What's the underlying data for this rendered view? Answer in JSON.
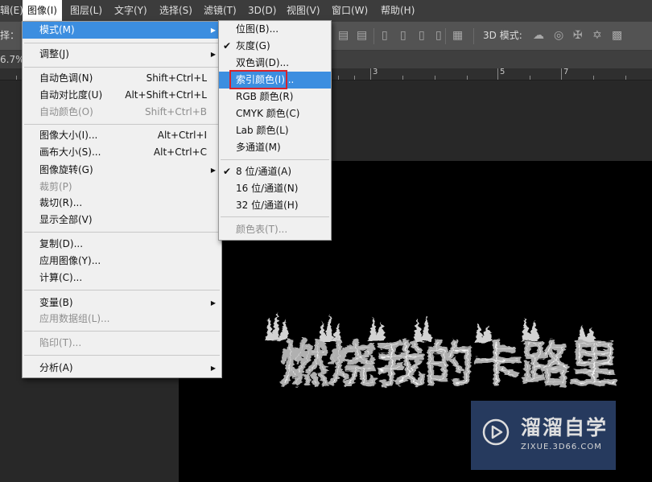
{
  "menubar": {
    "items": [
      {
        "label": "辑(E)"
      },
      {
        "label": "图像(I)"
      },
      {
        "label": "图层(L)"
      },
      {
        "label": "文字(Y)"
      },
      {
        "label": "选择(S)"
      },
      {
        "label": "滤镜(T)"
      },
      {
        "label": "3D(D)"
      },
      {
        "label": "视图(V)"
      },
      {
        "label": "窗口(W)"
      },
      {
        "label": "帮助(H)"
      }
    ]
  },
  "options_bar": {
    "select_label": "择：",
    "mode_3d_label": "3D 模式:"
  },
  "document": {
    "zoom": "6.7%"
  },
  "ruler": {
    "numbers": [
      "3",
      "5",
      "7"
    ]
  },
  "image_menu": {
    "items": [
      {
        "label": "模式(M)",
        "shortcut": ""
      },
      {
        "label": "调整(J)",
        "shortcut": ""
      },
      {
        "label": "自动色调(N)",
        "shortcut": "Shift+Ctrl+L"
      },
      {
        "label": "自动对比度(U)",
        "shortcut": "Alt+Shift+Ctrl+L"
      },
      {
        "label": "自动颜色(O)",
        "shortcut": "Shift+Ctrl+B"
      },
      {
        "label": "图像大小(I)...",
        "shortcut": "Alt+Ctrl+I"
      },
      {
        "label": "画布大小(S)...",
        "shortcut": "Alt+Ctrl+C"
      },
      {
        "label": "图像旋转(G)",
        "shortcut": ""
      },
      {
        "label": "裁剪(P)",
        "shortcut": ""
      },
      {
        "label": "裁切(R)...",
        "shortcut": ""
      },
      {
        "label": "显示全部(V)",
        "shortcut": ""
      },
      {
        "label": "复制(D)...",
        "shortcut": ""
      },
      {
        "label": "应用图像(Y)...",
        "shortcut": ""
      },
      {
        "label": "计算(C)...",
        "shortcut": ""
      },
      {
        "label": "变量(B)",
        "shortcut": ""
      },
      {
        "label": "应用数据组(L)...",
        "shortcut": ""
      },
      {
        "label": "陷印(T)...",
        "shortcut": ""
      },
      {
        "label": "分析(A)",
        "shortcut": ""
      }
    ]
  },
  "mode_submenu": {
    "items": [
      {
        "label": "位图(B)..."
      },
      {
        "label": "灰度(G)"
      },
      {
        "label": "双色调(D)..."
      },
      {
        "label": "索引颜色(I)..."
      },
      {
        "label": "RGB 颜色(R)"
      },
      {
        "label": "CMYK 颜色(C)"
      },
      {
        "label": "Lab 颜色(L)"
      },
      {
        "label": "多通道(M)"
      },
      {
        "label": "8 位/通道(A)"
      },
      {
        "label": "16 位/通道(N)"
      },
      {
        "label": "32 位/通道(H)"
      },
      {
        "label": "颜色表(T)..."
      }
    ]
  },
  "canvas": {
    "text": "燃烧我的卡路里"
  },
  "watermark": {
    "title": "溜溜自学",
    "url": "ZIXUE.3D66.COM"
  },
  "colors": {
    "highlight": "#3c8ee0",
    "emphasis_box": "#d8222a"
  }
}
